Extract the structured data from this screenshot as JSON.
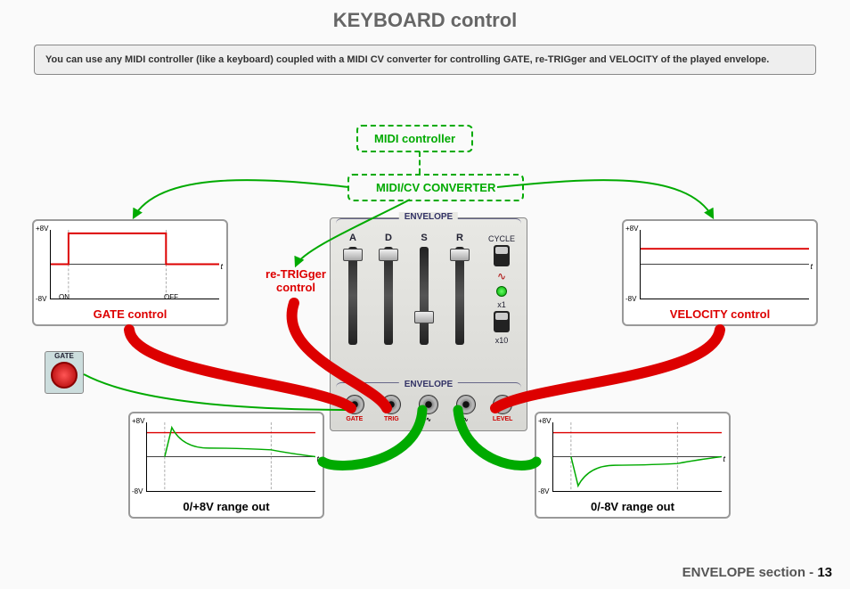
{
  "title": "KEYBOARD control",
  "info": "You can use any MIDI controller (like a keyboard) coupled with a MIDI CV converter for controlling GATE, re-TRIGger and VELOCITY of the played envelope.",
  "midi_controller": "MIDI controller",
  "midi_cv": "MIDI/CV CONVERTER",
  "retrig": "re-TRIGger control",
  "plots": {
    "gate": {
      "caption": "GATE control",
      "ytop": "+8V",
      "ybot": "-8V",
      "on": "ON",
      "off": "OFF",
      "xt": "t"
    },
    "vel": {
      "caption": "VELOCITY control",
      "ytop": "+8V",
      "ybot": "-8V",
      "xt": "t"
    },
    "pos": {
      "caption": "0/+8V range out",
      "ytop": "+8V",
      "ybot": "-8V",
      "xt": "t"
    },
    "neg": {
      "caption": "0/-8V range out",
      "ytop": "+8V",
      "ybot": "-8V",
      "xt": "t"
    }
  },
  "module": {
    "section_top": "ENVELOPE",
    "section_bottom": "ENVELOPE",
    "sliders": [
      "A",
      "D",
      "S",
      "R"
    ],
    "slider_positions_pct_from_top": [
      5,
      5,
      68,
      5
    ],
    "cycle_label": "CYCLE",
    "mult_x1": "x1",
    "mult_x10": "x10",
    "jacks": [
      {
        "label": "GATE",
        "color": "red"
      },
      {
        "label": "TRIG",
        "color": "red"
      },
      {
        "label": "∿",
        "color": "black"
      },
      {
        "label": "∿",
        "color": "black"
      },
      {
        "label": "LEVEL",
        "color": "red"
      }
    ]
  },
  "gate_button": "GATE",
  "footer_section": "ENVELOPE section - ",
  "footer_page": "13",
  "colors": {
    "red": "#d00000",
    "green": "#009900"
  }
}
